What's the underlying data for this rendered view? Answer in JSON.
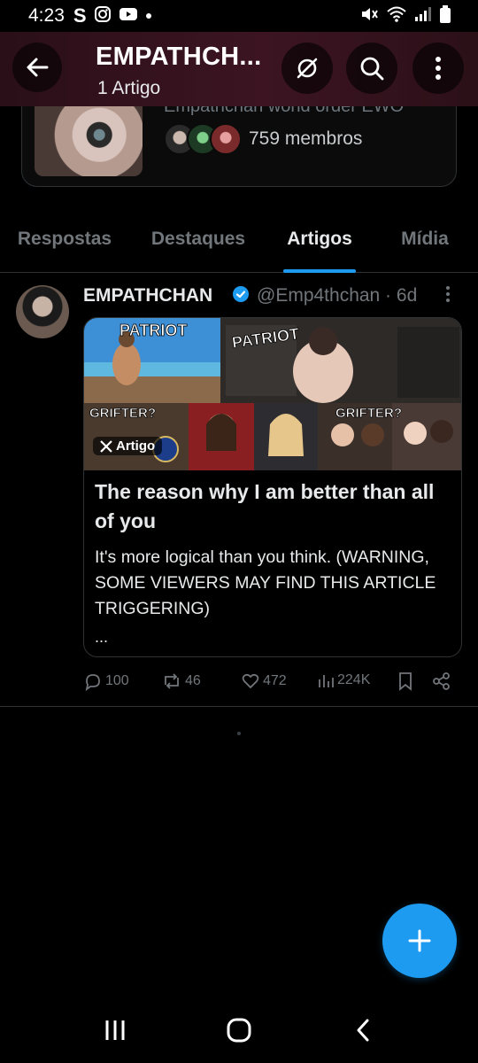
{
  "status_bar": {
    "time": "4:23",
    "left_icons": [
      "s-app-icon",
      "instagram-icon",
      "youtube-icon",
      "dot-icon"
    ],
    "right_icons": [
      "mute-icon",
      "wifi-icon",
      "signal-icon",
      "battery-icon"
    ]
  },
  "header": {
    "title": "EMPATHCH...",
    "subtitle": "1 Artigo"
  },
  "community": {
    "description": "Empathchan world order EWO",
    "members": "759 membros"
  },
  "tabs": [
    {
      "label": "Respostas",
      "active": false
    },
    {
      "label": "Destaques",
      "active": false
    },
    {
      "label": "Artigos",
      "active": true
    },
    {
      "label": "Mídia",
      "active": false
    }
  ],
  "post": {
    "name": "EMPATHCHAN",
    "handle": "@Emp4thchan · 6d",
    "article": {
      "badge": "Artigo",
      "image_text": [
        "PATRIOT",
        "PATRIOT",
        "GRIFTER?",
        "GRIFTER?"
      ],
      "title": "The reason why I am better than all of you",
      "description": "It's more logical than you think. (WARNING, SOME VIEWERS MAY FIND THIS ARTICLE TRIGGERING)",
      "ellipsis": "..."
    },
    "actions": {
      "replies": "100",
      "reposts": "46",
      "likes": "472",
      "views": "224K"
    }
  },
  "colors": {
    "accent": "#1d9bf0",
    "muted": "#71767b",
    "border": "#2f3336",
    "header_bg": "#3c1422"
  }
}
